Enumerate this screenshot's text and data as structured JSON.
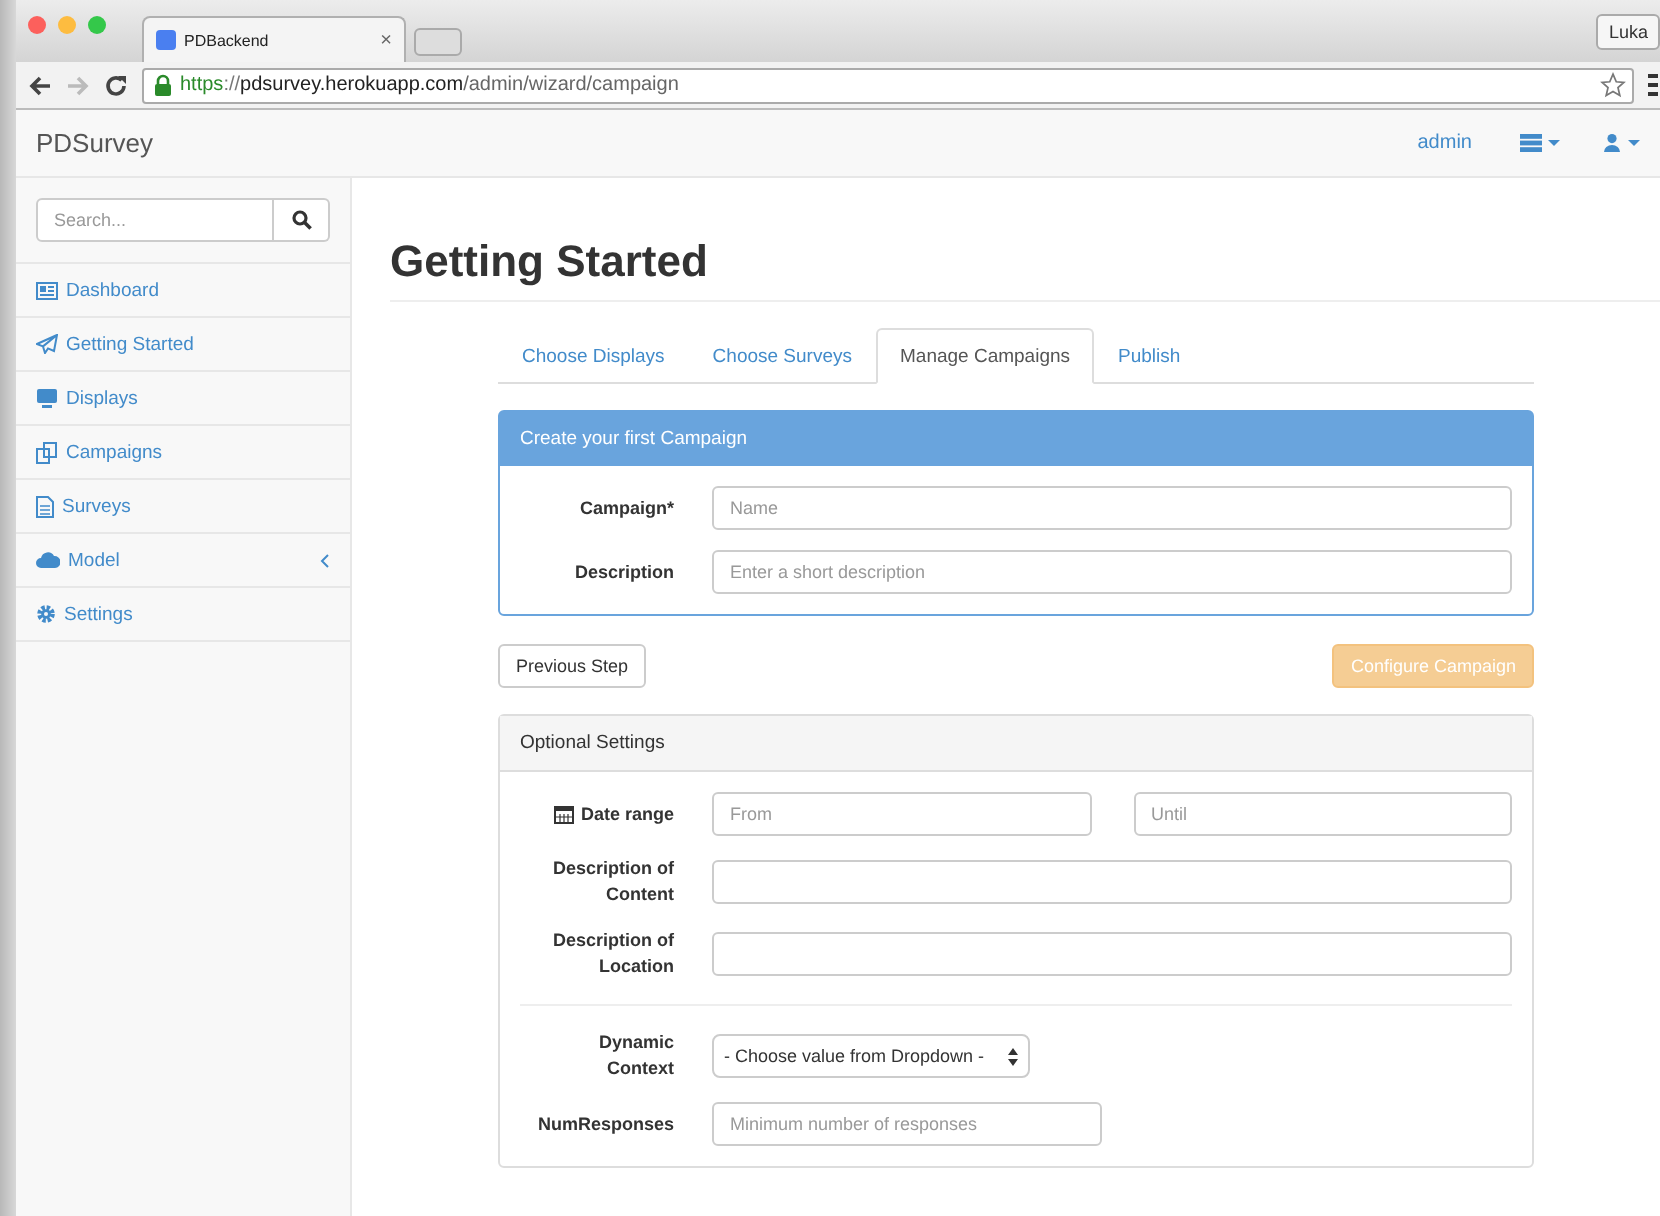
{
  "browser": {
    "tab_title": "PDBackend",
    "tab_close": "×",
    "profile": "Luka",
    "url": [
      {
        "kind": "scheme",
        "text": "https"
      },
      {
        "kind": "sep",
        "text": "://"
      },
      {
        "kind": "host",
        "text": "pdsurvey.herokuapp.com"
      },
      {
        "kind": "path",
        "text": "/admin/wizard/campaign"
      }
    ]
  },
  "navbar": {
    "brand": "PDSurvey",
    "user": "admin"
  },
  "sidebar": {
    "search": {
      "placeholder": "Search..."
    },
    "items": [
      {
        "label": "Dashboard",
        "has_submenu": false
      },
      {
        "label": "Getting Started",
        "has_submenu": false
      },
      {
        "label": "Displays",
        "has_submenu": false
      },
      {
        "label": "Campaigns",
        "has_submenu": false
      },
      {
        "label": "Surveys",
        "has_submenu": false
      },
      {
        "label": "Model",
        "has_submenu": true
      },
      {
        "label": "Settings",
        "has_submenu": false
      }
    ]
  },
  "page": {
    "title": "Getting Started",
    "tabs": [
      {
        "label": "Choose Displays",
        "selected": false
      },
      {
        "label": "Choose Surveys",
        "selected": false
      },
      {
        "label": "Manage Campaigns",
        "selected": true
      },
      {
        "label": "Publish",
        "selected": false
      }
    ],
    "campaign_panel": {
      "heading": "Create your first Campaign",
      "fields": [
        {
          "label": "Campaign*",
          "placeholder": "Name"
        },
        {
          "label": "Description",
          "placeholder": "Enter a short description"
        }
      ]
    },
    "buttons": [
      {
        "label": "Previous Step",
        "kind": "default",
        "disabled": false
      },
      {
        "label": "Configure Campaign",
        "kind": "primary",
        "disabled": true
      }
    ],
    "optional_panel": {
      "heading": "Optional Settings",
      "fields": [
        {
          "kind": "date_range",
          "label": "Date range",
          "inputs": [
            {
              "placeholder": "From"
            },
            {
              "placeholder": "Until"
            }
          ]
        },
        {
          "kind": "text",
          "label": "Description of Content"
        },
        {
          "kind": "text",
          "label": "Description of Location"
        },
        {
          "kind": "divider"
        },
        {
          "kind": "select",
          "label": "Dynamic Context",
          "value": "- Choose value from Dropdown -"
        },
        {
          "kind": "short",
          "label": "NumResponses",
          "placeholder": "Minimum number of responses"
        }
      ]
    }
  }
}
